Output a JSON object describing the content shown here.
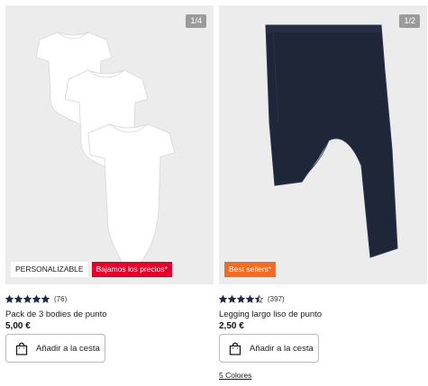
{
  "products": [
    {
      "image_counter": "1/4",
      "image_description": "three white short-sleeve baby bodysuits",
      "badges": [
        {
          "label": "PERSONALIZABLE",
          "style": "white"
        },
        {
          "label": "Bajamos los precios*",
          "style": "red",
          "color": "#e4002b"
        }
      ],
      "rating": 5,
      "review_count": "(76)",
      "name": "Pack de 3 bodies de punto",
      "price": "5,00 €",
      "add_to_cart_label": "Añadir a la cesta"
    },
    {
      "image_counter": "1/2",
      "image_description": "navy blue baby leggings",
      "badges": [
        {
          "label": "Best sellers*",
          "style": "orange",
          "color": "#f36c21"
        }
      ],
      "rating": 4.5,
      "review_count": "(397)",
      "name": "Legging largo liso de punto",
      "price": "2,50 €",
      "add_to_cart_label": "Añadir a la cesta",
      "colors_link": "5 Colores"
    }
  ],
  "icons": {
    "star": "star-icon",
    "cart": "shopping-bag-icon"
  },
  "colors": {
    "star": "#1f2a44",
    "image_background": "#ececec",
    "counter_background": "#9b9b9b"
  }
}
